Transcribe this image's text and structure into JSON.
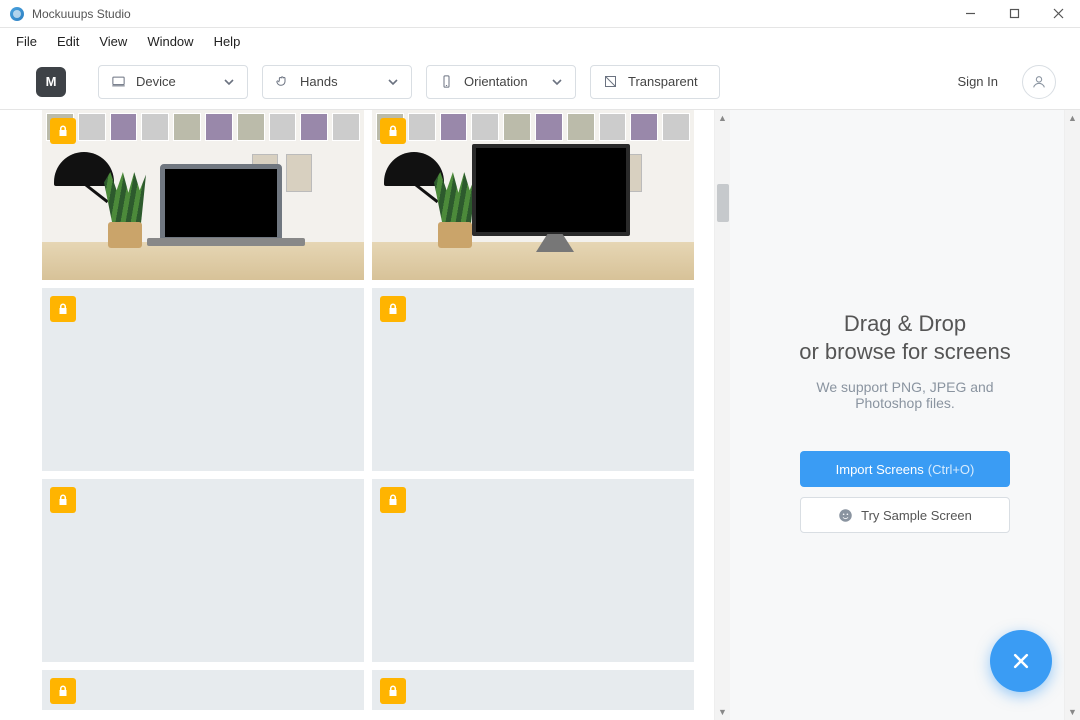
{
  "window": {
    "title": "Mockuuups Studio"
  },
  "menu": {
    "file": "File",
    "edit": "Edit",
    "view": "View",
    "window": "Window",
    "help": "Help"
  },
  "toolbar": {
    "logo": "M",
    "device": "Device",
    "hands": "Hands",
    "orientation": "Orientation",
    "transparent": "Transparent",
    "signin": "Sign In"
  },
  "panel": {
    "title_line1": "Drag & Drop",
    "title_line2": "or browse for screens",
    "sub_line1": "We support PNG, JPEG and",
    "sub_line2": "Photoshop files.",
    "import_label": "Import Screens",
    "import_hint": "(Ctrl+O)",
    "sample_label": "Try Sample Screen"
  }
}
